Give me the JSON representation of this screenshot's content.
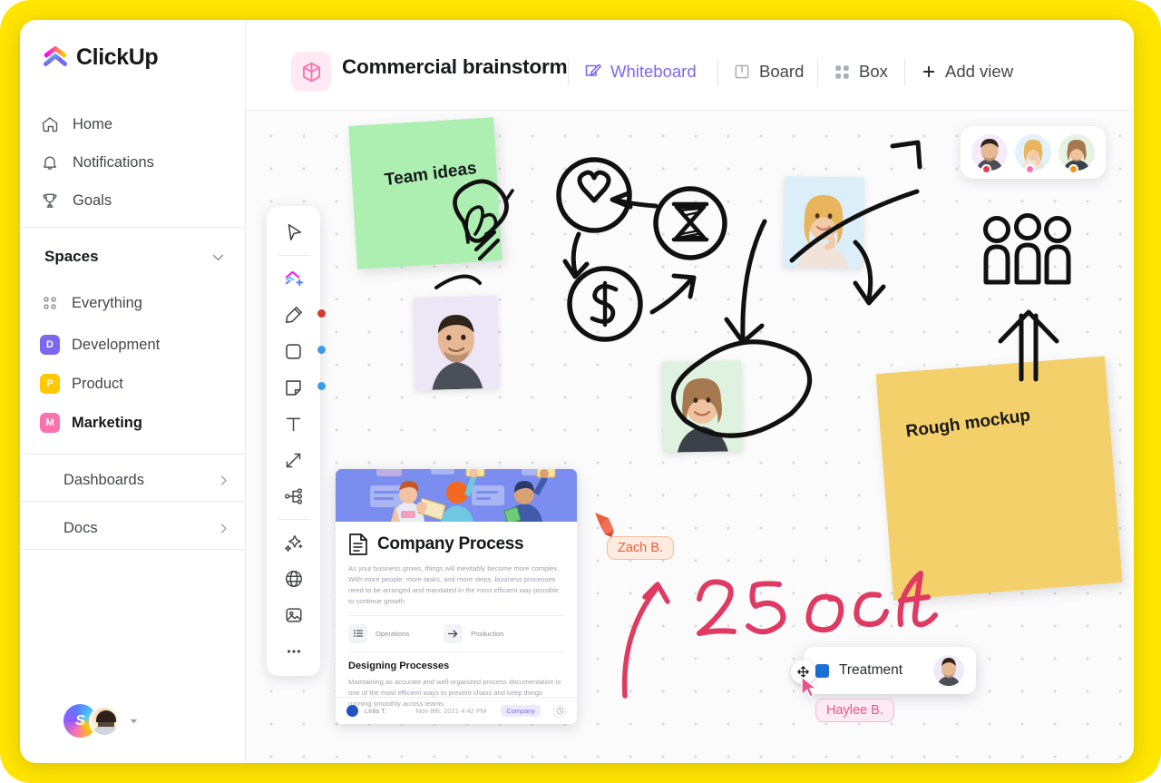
{
  "app": {
    "brand": "ClickUp"
  },
  "sidebar": {
    "nav": [
      {
        "label": "Home",
        "icon": "home-icon"
      },
      {
        "label": "Notifications",
        "icon": "bell-icon"
      },
      {
        "label": "Goals",
        "icon": "trophy-icon"
      }
    ],
    "spaces_header": "Spaces",
    "spaces": [
      {
        "label": "Everything",
        "icon": "grid-dots-icon",
        "initial": "",
        "color": ""
      },
      {
        "label": "Development",
        "initial": "D",
        "color": "#7B68EE"
      },
      {
        "label": "Product",
        "initial": "P",
        "color": "#FFC800"
      },
      {
        "label": "Marketing",
        "initial": "M",
        "color": "#FD71AF",
        "active": true
      }
    ],
    "footer_items": [
      {
        "label": "Dashboards",
        "icon": "chevron-right-icon"
      },
      {
        "label": "Docs",
        "icon": "chevron-right-icon"
      }
    ],
    "workspace_initial": "S"
  },
  "header": {
    "title": "Commercial brainstorm",
    "doc_icon": "box-3d-icon",
    "views": [
      {
        "label": "Whiteboard",
        "icon": "whiteboard-icon",
        "active": true
      },
      {
        "label": "Board",
        "icon": "board-icon",
        "active": false
      },
      {
        "label": "Box",
        "icon": "box-grid-icon",
        "active": false
      },
      {
        "label": "Add view",
        "icon": "plus-icon",
        "active": false
      }
    ]
  },
  "toolbar": {
    "tools": [
      {
        "name": "select-cursor-tool",
        "badge": ""
      },
      {
        "name": "shapes-add-tool",
        "badge": ""
      },
      {
        "name": "pen-marker-tool",
        "badge": "#D23B2E"
      },
      {
        "name": "rectangle-tool",
        "badge": "#3B9BE8"
      },
      {
        "name": "sticky-note-tool",
        "badge": "#3B9BE8"
      },
      {
        "name": "text-tool",
        "badge": ""
      },
      {
        "name": "connector-tool",
        "badge": ""
      },
      {
        "name": "mindmap-tool",
        "badge": ""
      },
      {
        "name": "magic-ai-tool",
        "badge": ""
      },
      {
        "name": "web-embed-tool",
        "badge": ""
      },
      {
        "name": "image-tool",
        "badge": ""
      },
      {
        "name": "more-tools",
        "badge": ""
      }
    ]
  },
  "canvas": {
    "sticky_notes": [
      {
        "text": "Team ideas",
        "color": "#ACEFB0"
      },
      {
        "text": "Rough mockup",
        "color": "#F3D06A"
      }
    ],
    "doodles": [
      "heart-circle-doodle",
      "hourglass-circle-doodle",
      "dollar-circle-doodle",
      "lightbulb-doodle",
      "people-group-doodle",
      "up-arrow-doodle",
      "ellipse-highlight-doodle",
      "curved-arrow-doodle"
    ],
    "handwriting": "25 oct",
    "handwriting_color": "#E03A63",
    "cursors": [
      {
        "name": "Zach B.",
        "color": "#E8613C",
        "bg": "#FDEBDF",
        "tool": "pencil-cursor"
      },
      {
        "name": "Haylee B.",
        "color": "#E8558F",
        "bg": "#FDEAF2",
        "tool": "arrow-cursor"
      }
    ],
    "treatment_card": {
      "label": "Treatment",
      "swatch": "#1A6FD4"
    },
    "collaborators": [
      {
        "name": "collaborator-1",
        "dot": "#E8384F",
        "bg": "#F6EBFA"
      },
      {
        "name": "collaborator-2",
        "dot": "#FD71AF",
        "bg": "#E2F1FB"
      },
      {
        "name": "collaborator-3",
        "dot": "#F2911B",
        "bg": "#E6F3E3"
      }
    ]
  },
  "doc_card": {
    "title": "Company Process",
    "paragraph": "As your business grows, things will inevitably become more complex. With more people, more tasks, and more steps, business processes need to be arranged and mandated in the most efficient way possible to continue growth.",
    "chips": [
      {
        "label": "Operations",
        "icon": "list-icon"
      },
      {
        "label": "Production",
        "icon": "arrow-right-icon"
      }
    ],
    "subtitle": "Designing Processes",
    "paragraph2": "Maintaining as accurate and well-organized process documentation is one of the most efficient ways to prevent chaos and keep things running smoothly across teams.",
    "author": "Leila T.",
    "date": "Nov 8th, 2021  4:42 PM",
    "badge": "Company"
  }
}
